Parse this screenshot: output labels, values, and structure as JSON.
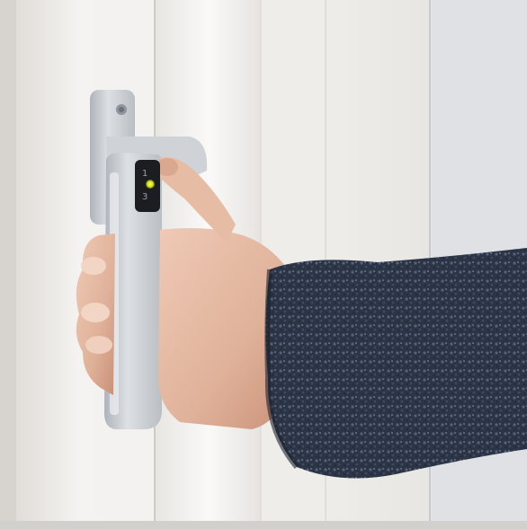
{
  "scene": {
    "subject": "hand-pressing-window-handle-fingerprint-button",
    "background_color": "#e9e6e1",
    "frame_color": "#f3f2ef",
    "handle_color": "#c9cdd2",
    "sensor_color": "#1b1d21",
    "indicator_color": "#e3f01a",
    "sleeve_color": "#2b3443",
    "skin_color": "#e1b69f"
  },
  "sensor_label": {
    "digits": [
      "1",
      "3"
    ]
  }
}
